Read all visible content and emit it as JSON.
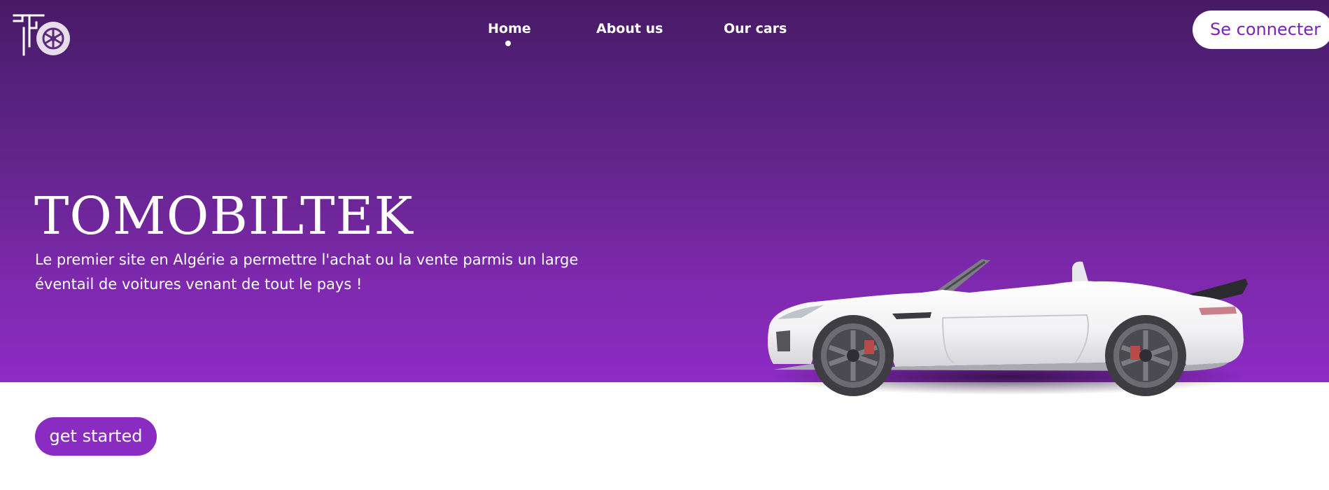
{
  "header": {
    "logo_icon": "tomobiltek-logo-wheel-icon",
    "nav": [
      {
        "label": "Home",
        "active": true
      },
      {
        "label": "About us",
        "active": false
      },
      {
        "label": "Our cars",
        "active": false
      }
    ],
    "login_label": "Se connecter"
  },
  "hero": {
    "title": "TOMOBILTEK",
    "description": "Le premier site en Algérie a permettre l'achat ou la vente parmis un large éventail de voitures venant de tout le pays !",
    "cta_label": "get started",
    "image": "white-convertible-sports-car"
  },
  "colors": {
    "gradient_top": "#471a65",
    "gradient_bottom": "#8d2bc4",
    "accent": "#8a2bc2",
    "login_text": "#7a23b8",
    "background": "#ffffff"
  }
}
